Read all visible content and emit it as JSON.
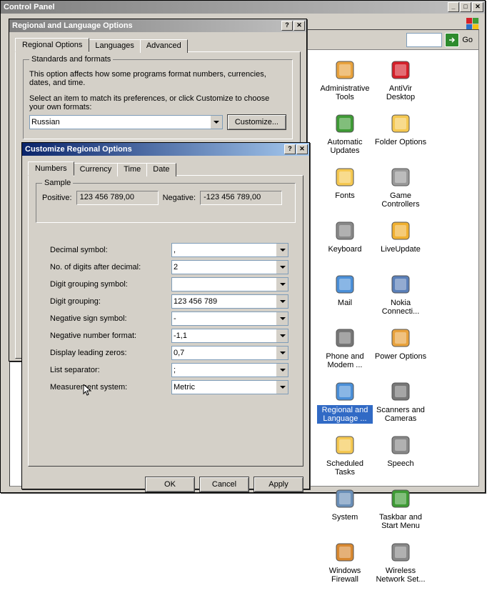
{
  "cp_title": "Control Panel",
  "go_label": "Go",
  "cp_items": [
    {
      "label": "Administrative Tools",
      "color": "#e8a23d"
    },
    {
      "label": "AntiVir Desktop",
      "color": "#d4202a"
    },
    {
      "label": "Automatic Updates",
      "color": "#3e9b35"
    },
    {
      "label": "Folder Options",
      "color": "#f5c851"
    },
    {
      "label": "Fonts",
      "color": "#f5c851"
    },
    {
      "label": "Game Controllers",
      "color": "#999999"
    },
    {
      "label": "Keyboard",
      "color": "#888888"
    },
    {
      "label": "LiveUpdate",
      "color": "#f0b030"
    },
    {
      "label": "Mail",
      "color": "#4a8fd8"
    },
    {
      "label": "Nokia Connecti...",
      "color": "#5a7fb8"
    },
    {
      "label": "Phone and Modem ...",
      "color": "#777777"
    },
    {
      "label": "Power Options",
      "color": "#e8a23d"
    },
    {
      "label": "Regional and Language ...",
      "color": "#4a8fd8",
      "selected": true
    },
    {
      "label": "Scanners and Cameras",
      "color": "#777777"
    },
    {
      "label": "Scheduled Tasks",
      "color": "#f5c851"
    },
    {
      "label": "Speech",
      "color": "#888888"
    },
    {
      "label": "System",
      "color": "#6a8fb8"
    },
    {
      "label": "Taskbar and Start Menu",
      "color": "#3e9b35"
    },
    {
      "label": "Windows Firewall",
      "color": "#d88830"
    },
    {
      "label": "Wireless Network Set...",
      "color": "#888888"
    }
  ],
  "regional": {
    "title": "Regional and Language Options",
    "tabs": [
      "Regional Options",
      "Languages",
      "Advanced"
    ],
    "group_title": "Standards and formats",
    "desc1": "This option affects how some programs format numbers, currencies, dates, and time.",
    "desc2": "Select an item to match its preferences, or click Customize to choose your own formats:",
    "locale": "Russian",
    "customize_btn": "Customize..."
  },
  "customize": {
    "title": "Customize Regional Options",
    "tabs": [
      "Numbers",
      "Currency",
      "Time",
      "Date"
    ],
    "sample_label": "Sample",
    "positive_label": "Positive:",
    "positive_val": "123 456 789,00",
    "negative_label": "Negative:",
    "negative_val": "-123 456 789,00",
    "fields": [
      {
        "label": "Decimal symbol:",
        "value": ","
      },
      {
        "label": "No. of digits after decimal:",
        "value": "2"
      },
      {
        "label": "Digit grouping symbol:",
        "value": ""
      },
      {
        "label": "Digit grouping:",
        "value": "123 456 789"
      },
      {
        "label": "Negative sign symbol:",
        "value": "-"
      },
      {
        "label": "Negative number format:",
        "value": "-1,1"
      },
      {
        "label": "Display leading zeros:",
        "value": "0,7"
      },
      {
        "label": "List separator:",
        "value": ";"
      },
      {
        "label": "Measurement system:",
        "value": "Metric"
      }
    ],
    "ok": "OK",
    "cancel": "Cancel",
    "apply": "Apply"
  }
}
